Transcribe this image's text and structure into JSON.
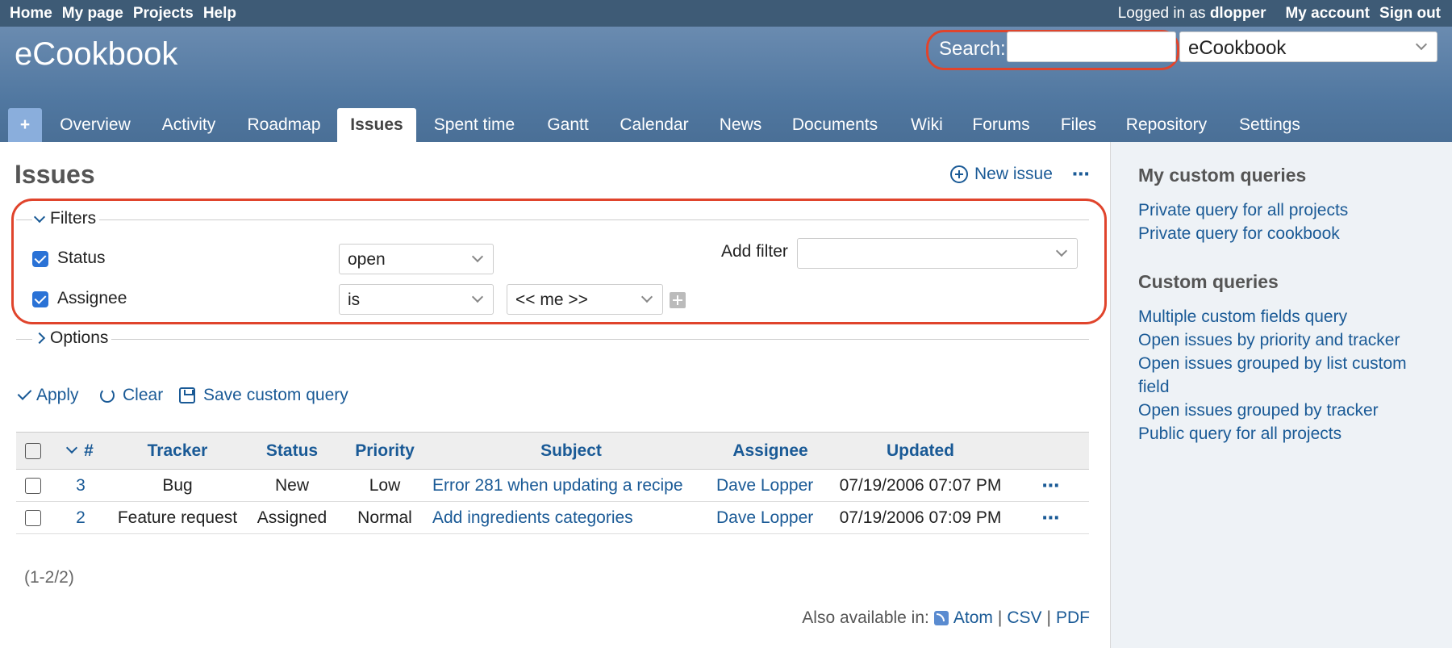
{
  "top_menu": {
    "left": [
      "Home",
      "My page",
      "Projects",
      "Help"
    ],
    "logged_prefix": "Logged in as",
    "user": "dlopper",
    "my_account": "My account",
    "sign_out": "Sign out"
  },
  "header": {
    "project_title": "eCookbook",
    "search_label": "Search:",
    "search_value": "",
    "project_jump": "eCookbook"
  },
  "tabs": [
    "+",
    "Overview",
    "Activity",
    "Roadmap",
    "Issues",
    "Spent time",
    "Gantt",
    "Calendar",
    "News",
    "Documents",
    "Wiki",
    "Forums",
    "Files",
    "Repository",
    "Settings"
  ],
  "selected_tab": "Issues",
  "content": {
    "title": "Issues",
    "new_issue": "New issue",
    "more": "⋯"
  },
  "filters": {
    "legend": "Filters",
    "status_label": "Status",
    "status_operator": "open",
    "assignee_label": "Assignee",
    "assignee_operator": "is",
    "assignee_value": "<< me >>",
    "add_filter_label": "Add filter",
    "add_filter_value": ""
  },
  "options": {
    "legend": "Options"
  },
  "actions": {
    "apply": "Apply",
    "clear": "Clear",
    "save": "Save custom query"
  },
  "table": {
    "headers": [
      "#",
      "Tracker",
      "Status",
      "Priority",
      "Subject",
      "Assignee",
      "Updated"
    ],
    "rows": [
      {
        "id": "3",
        "tracker": "Bug",
        "status": "New",
        "priority": "Low",
        "subject": "Error 281 when updating a recipe",
        "assignee": "Dave Lopper",
        "updated": "07/19/2006 07:07 PM"
      },
      {
        "id": "2",
        "tracker": "Feature request",
        "status": "Assigned",
        "priority": "Normal",
        "subject": "Add ingredients categories",
        "assignee": "Dave Lopper",
        "updated": "07/19/2006 07:09 PM"
      }
    ]
  },
  "pagination": "(1-2/2)",
  "other_formats": {
    "label": "Also available in:",
    "atom": "Atom",
    "csv": "CSV",
    "pdf": "PDF",
    "sep": "|"
  },
  "sidebar": {
    "my_queries_title": "My custom queries",
    "my_queries": [
      "Private query for all projects",
      "Private query for cookbook"
    ],
    "queries_title": "Custom queries",
    "queries": [
      "Multiple custom fields query",
      "Open issues by priority and tracker",
      "Open issues grouped by list custom field",
      "Open issues grouped by tracker",
      "Public query for all projects"
    ]
  },
  "colors": {
    "header": "#5077a0",
    "top_menu": "#3e5b76",
    "link": "#1a5a96",
    "highlight": "#e0442c"
  }
}
